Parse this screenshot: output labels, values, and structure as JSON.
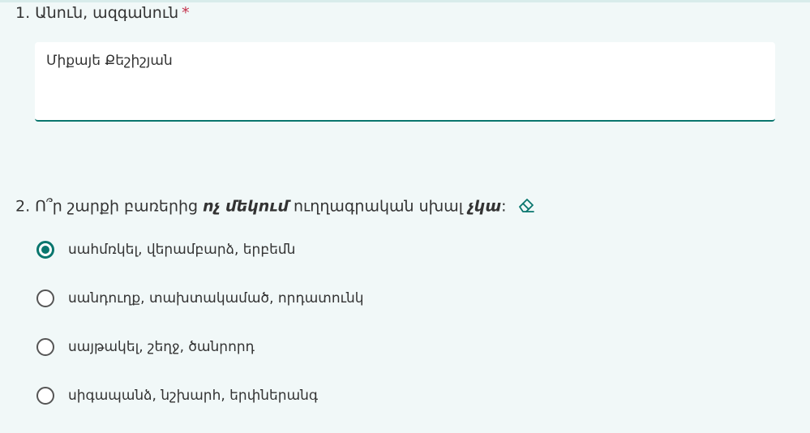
{
  "question1": {
    "title": "1. Անուն, ազգանուն",
    "required_mark": "*",
    "answer": "Միքայե Քեշիշյան"
  },
  "question2": {
    "title_before": "2. Ո՞ր շարքի բառերից ",
    "title_emphasis1": "ոչ մեկում",
    "title_middle": " ուղղագրական սխալ ",
    "title_emphasis2": "չկա",
    "title_after": ":",
    "eraser_icon": "eraser-icon",
    "options": [
      {
        "label": "սահմռկել, վերամբարձ, երբեմն",
        "checked": true
      },
      {
        "label": "սանդուղք, տախտակամած, որդատունկ",
        "checked": false
      },
      {
        "label": "սայթակել, շեղջ, ծանրորդ",
        "checked": false
      },
      {
        "label": "սիգապանձ, նշխարհ, երփներանգ",
        "checked": false
      }
    ]
  },
  "colors": {
    "accent": "#0a766e",
    "background": "#f1f8f8",
    "required": "#c4314b"
  }
}
